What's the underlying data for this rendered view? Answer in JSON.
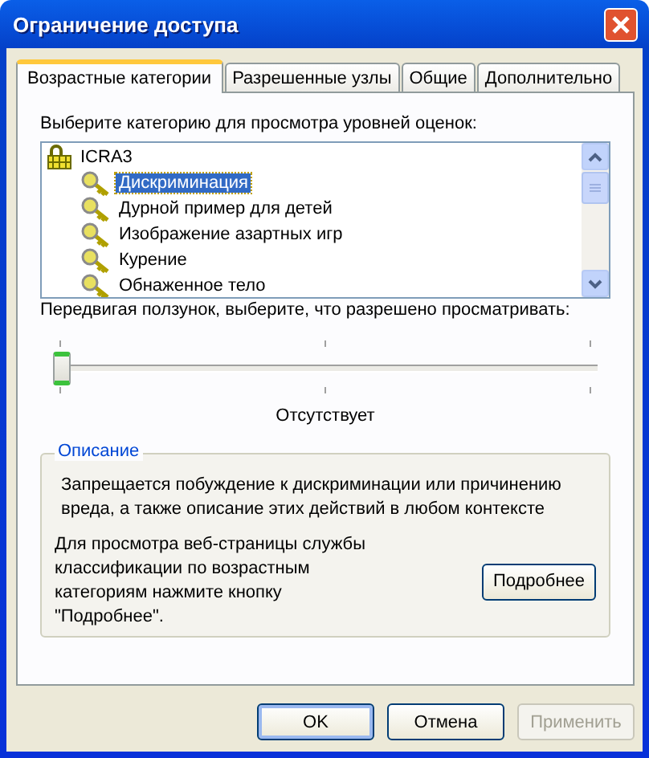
{
  "window": {
    "title": "Ограничение доступа"
  },
  "tabs": [
    {
      "label": "Возрастные категории",
      "selected": true
    },
    {
      "label": "Разрешенные узлы",
      "selected": false
    },
    {
      "label": "Общие",
      "selected": false
    },
    {
      "label": "Дополнительно",
      "selected": false
    }
  ],
  "category_prompt": "Выберите категорию для просмотра уровней оценок:",
  "category_tree": [
    {
      "label": "ICRA3",
      "children": [
        {
          "label": "Дискриминация",
          "selected": true
        },
        {
          "label": "Дурной пример для детей",
          "selected": false
        },
        {
          "label": "Изображение азартных игр",
          "selected": false
        },
        {
          "label": "Курение",
          "selected": false
        },
        {
          "label": "Обнаженное тело",
          "selected": false
        }
      ]
    }
  ],
  "slider_prompt": "Передвигая ползунок, выберите, что разрешено просматривать:",
  "slider": {
    "level": 0,
    "reading": "Отсутствует"
  },
  "description": {
    "title": "Описание",
    "text": "Запрещается побуждение к дискриминации или причинению вреда, а также описание этих действий в любом контексте",
    "info": "Для просмотра веб-страницы службы классификации по возрастным категориям нажмите кнопку \"Подробнее\".",
    "button": "Подробнее"
  },
  "buttons": [
    {
      "label": "OK",
      "default": true,
      "disabled": false
    },
    {
      "label": "Отмена",
      "default": false,
      "disabled": false
    },
    {
      "label": "Применить",
      "default": false,
      "disabled": true
    }
  ]
}
